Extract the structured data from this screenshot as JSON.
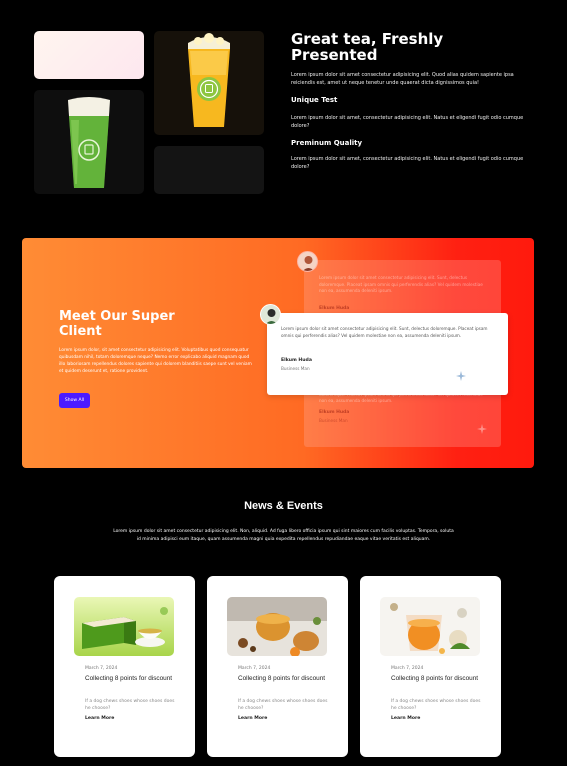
{
  "hero": {
    "title": "Great tea, Freshly Presented",
    "intro": "Lorem ipsum dolor sit amet consectetur adipisicing elit. Quod alias quidem sapiente ipsa reiciendis est, amet ut neque tenetur unde quaerat dicta dignissimos quia!",
    "features": [
      {
        "title": "Unique Test",
        "text": "Lorem ipsum dolor sit amet, consectetur adipisicing elit. Natus et eligendi fugit odio cumque dolore?"
      },
      {
        "title": "Preminum Quality",
        "text": "Lorem ipsum dolor sit amet, consectetur adipisicing elit. Natus et eligendi fugit odio cumque dolore?"
      }
    ]
  },
  "clients": {
    "title": "Meet Our Super Client",
    "text": "Lorem ipsum dolor, sit amet consectetur adipisicing elit. Voluptatibus quod consequatur quibusdam nihil, totam doloremque neque? Nemo error explicabo aliquid magnam quod illo laboriosam repellendus dolores sapiente qui dolorem blanditiis saepe sunt vel veniam et quidem deserunt et, ratione provident.",
    "button_label": "Show All",
    "testimonial": {
      "text": "Lorem ipsum dolor sit amet consectetur adipisicing elit. Sunt, delectus doloremque. Placeat ipsam omnis qui perferendis alias? Vel quidem molestiae non ea, assumenda deleniti ipsum.",
      "name": "Elkum Huda",
      "role": "Business Man"
    }
  },
  "news": {
    "title": "News & Events",
    "text": "Lorem ipsum dolor sit amet consectetur adipisicing elit. Non, aliquid. Ad fuga libero officia ipsum qui sint maiores cum facilis voluptas. Tempora, soluta id minima adipisci eum itaque, quam assumenda magni quia expedita repellendus repudiandae eaque vitae veritatis est aliquam.",
    "cards": [
      {
        "date": "March 7, 2024",
        "title": "Collecting 8 points for discount",
        "excerpt": "If a dog chews shoes whose shoes does he choose?",
        "more": "Learn More"
      },
      {
        "date": "March 7, 2024",
        "title": "Collecting 8 points for discount",
        "excerpt": "If a dog chews shoes whose shoes does he choose?",
        "more": "Learn More"
      },
      {
        "date": "March 7, 2024",
        "title": "Collecting 8 points for discount",
        "excerpt": "If a dog chews shoes whose shoes does he choose?",
        "more": "Learn More"
      }
    ]
  },
  "colors": {
    "accent": "#4b1bff",
    "banner_start": "#ff8c35",
    "banner_end": "#ff1a0d"
  }
}
